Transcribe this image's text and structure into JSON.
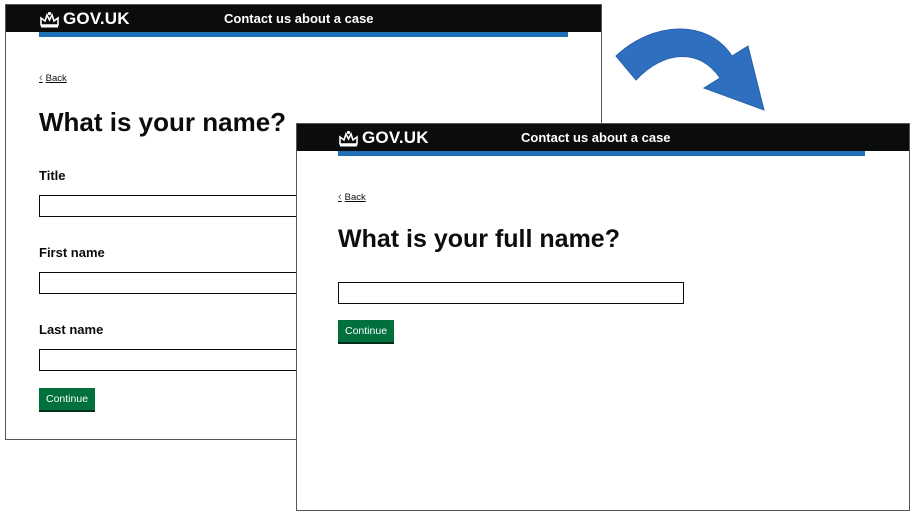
{
  "screens": [
    {
      "header": {
        "brand": "GOV.UK",
        "service_name": "Contact us about a case"
      },
      "back_link": "Back",
      "heading": "What is your name?",
      "fields": [
        {
          "label": "Title",
          "value": ""
        },
        {
          "label": "First name",
          "value": ""
        },
        {
          "label": "Last name",
          "value": ""
        }
      ],
      "continue_label": "Continue"
    },
    {
      "header": {
        "brand": "GOV.UK",
        "service_name": "Contact us about a case"
      },
      "back_link": "Back",
      "heading": "What is your full name?",
      "fields": [
        {
          "label": "",
          "value": ""
        }
      ],
      "continue_label": "Continue"
    }
  ],
  "colors": {
    "header_bg": "#0b0c0c",
    "header_bar": "#1d70b8",
    "button_green": "#00703c",
    "arrow_blue": "#2f6fbf"
  },
  "icons": {
    "brand": "crown-icon",
    "back": "chevron-left-icon",
    "transition": "curved-arrow-icon"
  }
}
